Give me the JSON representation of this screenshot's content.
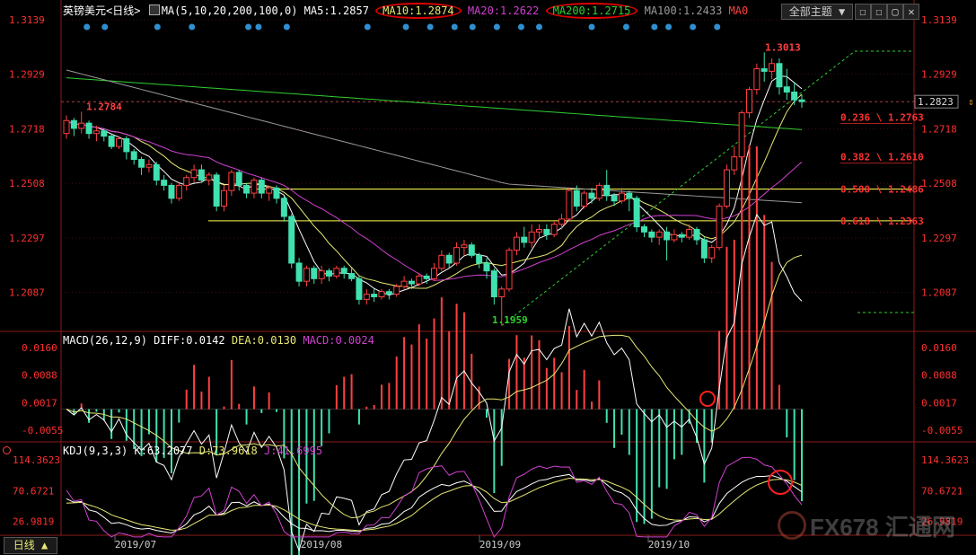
{
  "title": "英镑美元",
  "period_tag": "<日线>",
  "theme_button": "全部主题",
  "period_button": "日线",
  "ma_header": {
    "params": "MA(5,10,20,200,100,0)",
    "items": [
      {
        "label": "MA5",
        "value": "1.2857",
        "color": "#ffffff"
      },
      {
        "label": "MA10",
        "value": "1.2874",
        "color": "#e8e874"
      },
      {
        "label": "MA20",
        "value": "1.2622",
        "color": "#d040d0"
      },
      {
        "label": "MA200",
        "value": "1.2715",
        "color": "#30d030"
      },
      {
        "label": "MA100",
        "value": "1.2433",
        "color": "#9a9a9a"
      },
      {
        "label": "MA0",
        "value": "",
        "color": "#ff4040"
      }
    ]
  },
  "macd_header": {
    "label": "MACD(26,12,9)",
    "diff": "DIFF:0.0142",
    "dea": "DEA:0.0130",
    "macd": "MACD:0.0024"
  },
  "kdj_header": {
    "label": "KDJ(9,3,3)",
    "k": "K:63.2077",
    "d": "D:73.9618",
    "j": "J:41.6995"
  },
  "watermark": "FX678 汇通网",
  "colors": {
    "up": "#ff4040",
    "down": "#40e0b0",
    "grid": "#8b1a1a",
    "axis": "#ff3030",
    "fib": "#ffff50",
    "current": "#aaaaaa"
  },
  "chart_data": {
    "type": "candlestick",
    "price_axis": [
      "1.3139",
      "1.2929",
      "1.2718",
      "1.2508",
      "1.2297",
      "1.2087"
    ],
    "price_ylim": [
      1.194,
      1.3139
    ],
    "macd_axis": [
      "0.0160",
      "0.0088",
      "0.0017",
      "-0.0055"
    ],
    "macd_ylim": [
      -0.008,
      0.0185
    ],
    "kdj_axis": [
      "114.3623",
      "70.6721",
      "26.9819"
    ],
    "kdj_ylim": [
      10,
      130
    ],
    "dates": [
      "2019/07",
      "2019/08",
      "2019/09",
      "2019/10"
    ],
    "current_price": "1.2823",
    "high_label": "1.3013",
    "low_label": "1.1959",
    "left_high_label": "1.2784",
    "fib_levels": [
      {
        "ratio": "0.236",
        "price": "1.2763"
      },
      {
        "ratio": "0.382",
        "price": "1.2610"
      },
      {
        "ratio": "0.500",
        "price": "1.2486"
      },
      {
        "ratio": "0.618",
        "price": "1.2363"
      }
    ],
    "candles": [
      [
        1.27,
        1.275,
        1.268,
        1.277
      ],
      [
        1.275,
        1.272,
        1.269,
        1.276
      ],
      [
        1.272,
        1.274,
        1.27,
        1.2784
      ],
      [
        1.274,
        1.27,
        1.268,
        1.275
      ],
      [
        1.27,
        1.271,
        1.267,
        1.273
      ],
      [
        1.271,
        1.269,
        1.267,
        1.272
      ],
      [
        1.269,
        1.265,
        1.264,
        1.27
      ],
      [
        1.265,
        1.268,
        1.264,
        1.269
      ],
      [
        1.268,
        1.263,
        1.26,
        1.269
      ],
      [
        1.263,
        1.26,
        1.258,
        1.264
      ],
      [
        1.26,
        1.257,
        1.254,
        1.261
      ],
      [
        1.257,
        1.258,
        1.255,
        1.26
      ],
      [
        1.258,
        1.252,
        1.25,
        1.259
      ],
      [
        1.252,
        1.25,
        1.248,
        1.254
      ],
      [
        1.25,
        1.245,
        1.243,
        1.251
      ],
      [
        1.245,
        1.25,
        1.244,
        1.251
      ],
      [
        1.25,
        1.253,
        1.248,
        1.254
      ],
      [
        1.253,
        1.256,
        1.251,
        1.258
      ],
      [
        1.256,
        1.252,
        1.251,
        1.258
      ],
      [
        1.252,
        1.254,
        1.25,
        1.255
      ],
      [
        1.254,
        1.242,
        1.24,
        1.255
      ],
      [
        1.242,
        1.248,
        1.24,
        1.25
      ],
      [
        1.248,
        1.255,
        1.246,
        1.256
      ],
      [
        1.255,
        1.25,
        1.248,
        1.256
      ],
      [
        1.25,
        1.247,
        1.245,
        1.251
      ],
      [
        1.247,
        1.252,
        1.245,
        1.253
      ],
      [
        1.252,
        1.247,
        1.245,
        1.253
      ],
      [
        1.247,
        1.249,
        1.244,
        1.25
      ],
      [
        1.249,
        1.245,
        1.243,
        1.25
      ],
      [
        1.245,
        1.238,
        1.236,
        1.246
      ],
      [
        1.238,
        1.22,
        1.218,
        1.239
      ],
      [
        1.22,
        1.213,
        1.211,
        1.222
      ],
      [
        1.213,
        1.218,
        1.211,
        1.219
      ],
      [
        1.218,
        1.214,
        1.212,
        1.219
      ],
      [
        1.214,
        1.217,
        1.212,
        1.219
      ],
      [
        1.217,
        1.215,
        1.213,
        1.218
      ],
      [
        1.215,
        1.218,
        1.214,
        1.219
      ],
      [
        1.218,
        1.216,
        1.214,
        1.219
      ],
      [
        1.216,
        1.214,
        1.213,
        1.218
      ],
      [
        1.214,
        1.206,
        1.204,
        1.215
      ],
      [
        1.206,
        1.208,
        1.204,
        1.21
      ],
      [
        1.208,
        1.207,
        1.205,
        1.21
      ],
      [
        1.207,
        1.209,
        1.206,
        1.21
      ],
      [
        1.209,
        1.208,
        1.206,
        1.21
      ],
      [
        1.208,
        1.211,
        1.207,
        1.212
      ],
      [
        1.211,
        1.213,
        1.21,
        1.215
      ],
      [
        1.213,
        1.212,
        1.21,
        1.214
      ],
      [
        1.212,
        1.215,
        1.211,
        1.216
      ],
      [
        1.215,
        1.214,
        1.212,
        1.216
      ],
      [
        1.214,
        1.218,
        1.213,
        1.22
      ],
      [
        1.218,
        1.223,
        1.217,
        1.225
      ],
      [
        1.223,
        1.22,
        1.218,
        1.224
      ],
      [
        1.22,
        1.226,
        1.219,
        1.228
      ],
      [
        1.226,
        1.227,
        1.223,
        1.229
      ],
      [
        1.227,
        1.223,
        1.222,
        1.228
      ],
      [
        1.223,
        1.22,
        1.218,
        1.224
      ],
      [
        1.22,
        1.217,
        1.214,
        1.222
      ],
      [
        1.217,
        1.207,
        1.204,
        1.218
      ],
      [
        1.207,
        1.21,
        1.1959,
        1.211
      ],
      [
        1.21,
        1.225,
        1.209,
        1.226
      ],
      [
        1.225,
        1.23,
        1.223,
        1.232
      ],
      [
        1.23,
        1.228,
        1.226,
        1.234
      ],
      [
        1.228,
        1.232,
        1.226,
        1.235
      ],
      [
        1.232,
        1.233,
        1.23,
        1.235
      ],
      [
        1.233,
        1.231,
        1.229,
        1.235
      ],
      [
        1.231,
        1.235,
        1.23,
        1.236
      ],
      [
        1.235,
        1.237,
        1.233,
        1.239
      ],
      [
        1.237,
        1.248,
        1.236,
        1.249
      ],
      [
        1.248,
        1.242,
        1.24,
        1.25
      ],
      [
        1.242,
        1.247,
        1.241,
        1.248
      ],
      [
        1.247,
        1.245,
        1.243,
        1.249
      ],
      [
        1.245,
        1.25,
        1.244,
        1.251
      ],
      [
        1.25,
        1.246,
        1.244,
        1.256
      ],
      [
        1.246,
        1.244,
        1.242,
        1.247
      ],
      [
        1.244,
        1.247,
        1.243,
        1.249
      ],
      [
        1.247,
        1.245,
        1.24,
        1.248
      ],
      [
        1.245,
        1.234,
        1.232,
        1.246
      ],
      [
        1.234,
        1.232,
        1.23,
        1.235
      ],
      [
        1.232,
        1.23,
        1.228,
        1.233
      ],
      [
        1.23,
        1.232,
        1.227,
        1.233
      ],
      [
        1.232,
        1.229,
        1.221,
        1.234
      ],
      [
        1.229,
        1.231,
        1.228,
        1.233
      ],
      [
        1.231,
        1.23,
        1.228,
        1.232
      ],
      [
        1.23,
        1.233,
        1.229,
        1.235
      ],
      [
        1.233,
        1.229,
        1.227,
        1.234
      ],
      [
        1.229,
        1.222,
        1.22,
        1.23
      ],
      [
        1.222,
        1.226,
        1.22,
        1.227
      ],
      [
        1.226,
        1.242,
        1.225,
        1.243
      ],
      [
        1.242,
        1.256,
        1.241,
        1.258
      ],
      [
        1.256,
        1.261,
        1.254,
        1.265
      ],
      [
        1.261,
        1.278,
        1.26,
        1.279
      ],
      [
        1.278,
        1.287,
        1.276,
        1.288
      ],
      [
        1.287,
        1.295,
        1.285,
        1.297
      ],
      [
        1.295,
        1.294,
        1.29,
        1.3013
      ],
      [
        1.294,
        1.297,
        1.291,
        1.299
      ],
      [
        1.297,
        1.288,
        1.285,
        1.299
      ],
      [
        1.288,
        1.286,
        1.283,
        1.295
      ],
      [
        1.286,
        1.283,
        1.281,
        1.29
      ],
      [
        1.283,
        1.2823,
        1.28,
        1.285
      ]
    ]
  }
}
